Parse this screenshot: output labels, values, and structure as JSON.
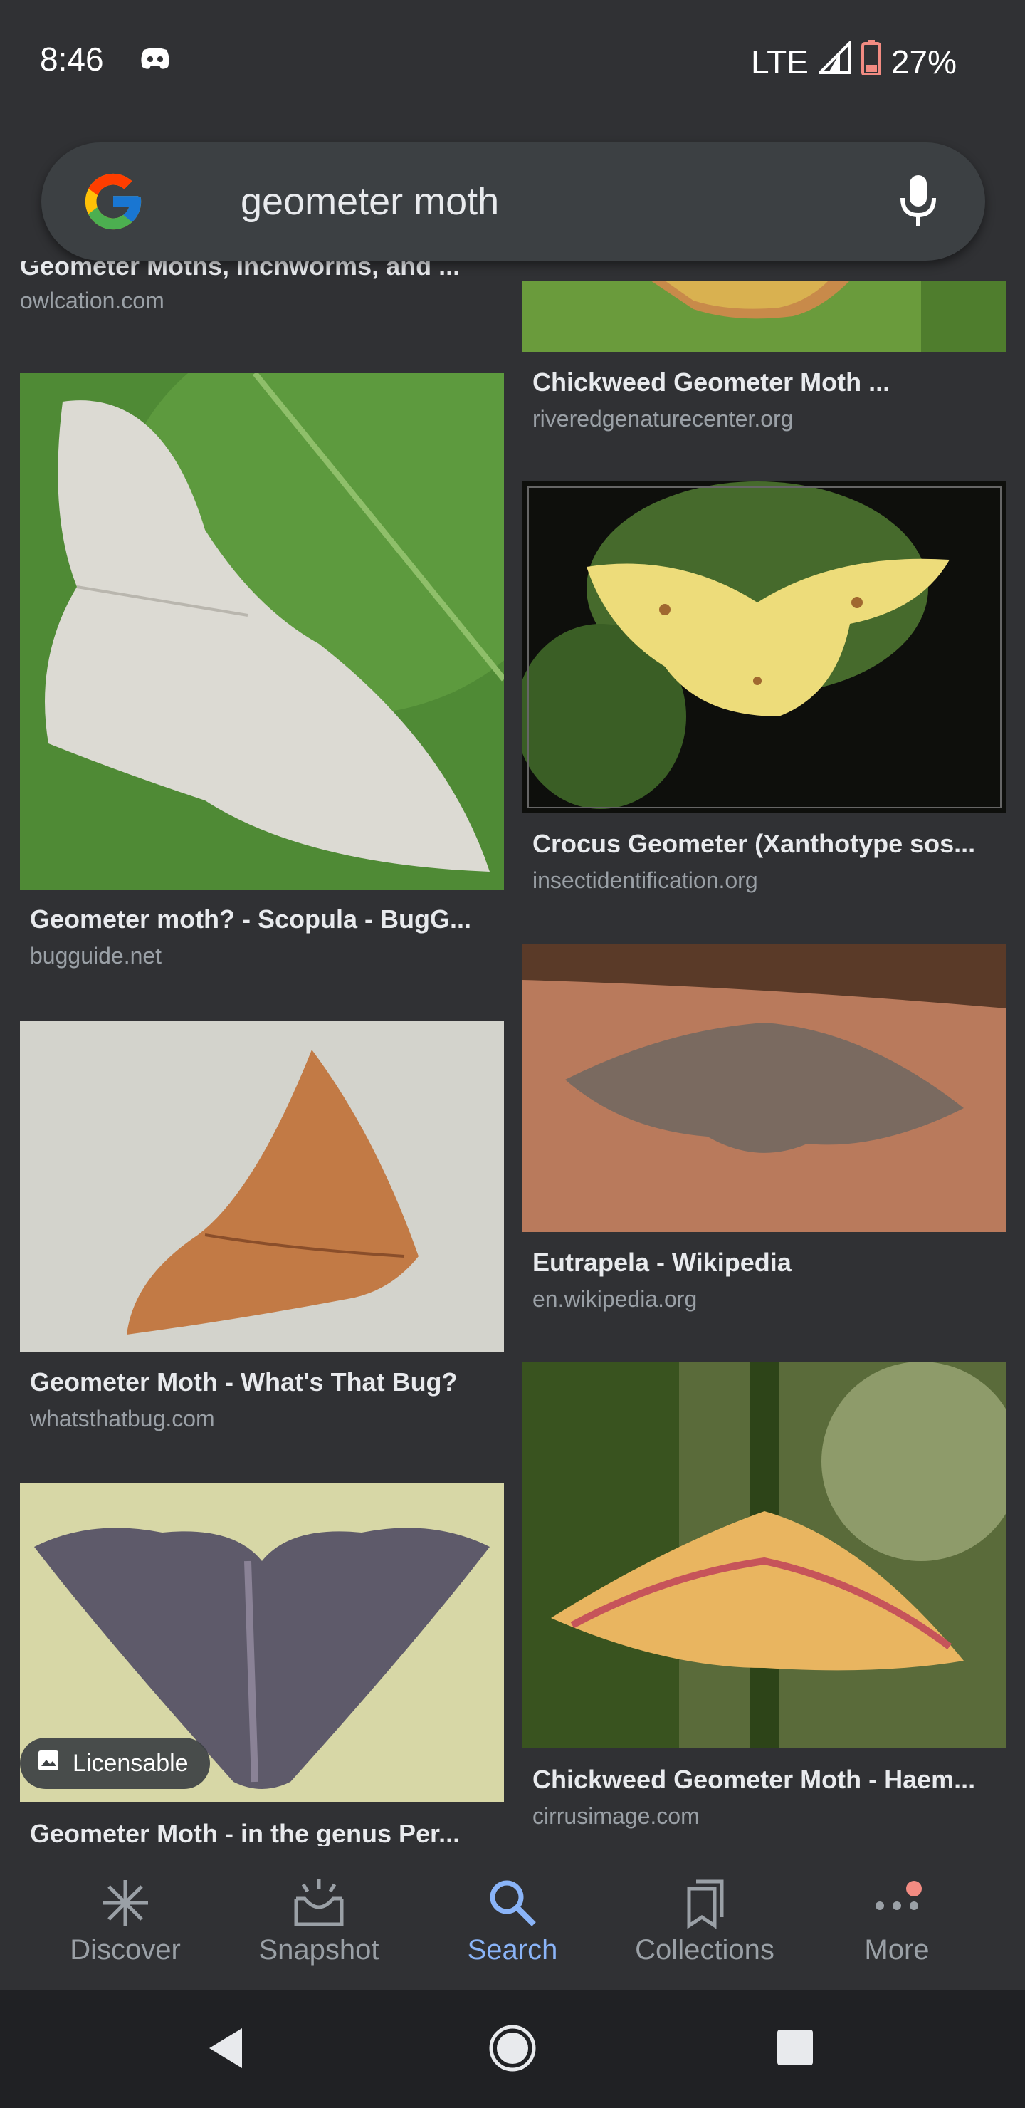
{
  "status_bar": {
    "time": "8:46",
    "network": "LTE",
    "battery": "27%"
  },
  "search": {
    "query": "geometer moth"
  },
  "results": [
    {
      "title": "Geometer Moths, Inchworms, and ...",
      "site": "owlcation.com"
    },
    {
      "title": "Chickweed Geometer Moth ...",
      "site": "riveredgenaturecenter.org"
    },
    {
      "title": "Geometer moth? - Scopula - BugG...",
      "site": "bugguide.net"
    },
    {
      "title": "Crocus Geometer (Xanthotype sos...",
      "site": "insectidentification.org"
    },
    {
      "title": "Eutrapela - Wikipedia",
      "site": "en.wikipedia.org"
    },
    {
      "title": "Geometer Moth - What's That Bug?",
      "site": "whatsthatbug.com"
    },
    {
      "title": "Chickweed Geometer Moth - Haem...",
      "site": "cirrusimage.com"
    },
    {
      "title": "Geometer Moth - in the genus Per...",
      "site": ""
    }
  ],
  "licensable_badge": "Licensable",
  "bottom_nav": [
    {
      "label": "Discover",
      "icon": "asterisk-icon"
    },
    {
      "label": "Snapshot",
      "icon": "snapshot-icon"
    },
    {
      "label": "Search",
      "icon": "search-icon"
    },
    {
      "label": "Collections",
      "icon": "collections-icon"
    },
    {
      "label": "More",
      "icon": "more-dots-icon"
    }
  ],
  "colors": {
    "background": "#303134",
    "active": "#8ab4f8",
    "notification": "#f28b82"
  }
}
